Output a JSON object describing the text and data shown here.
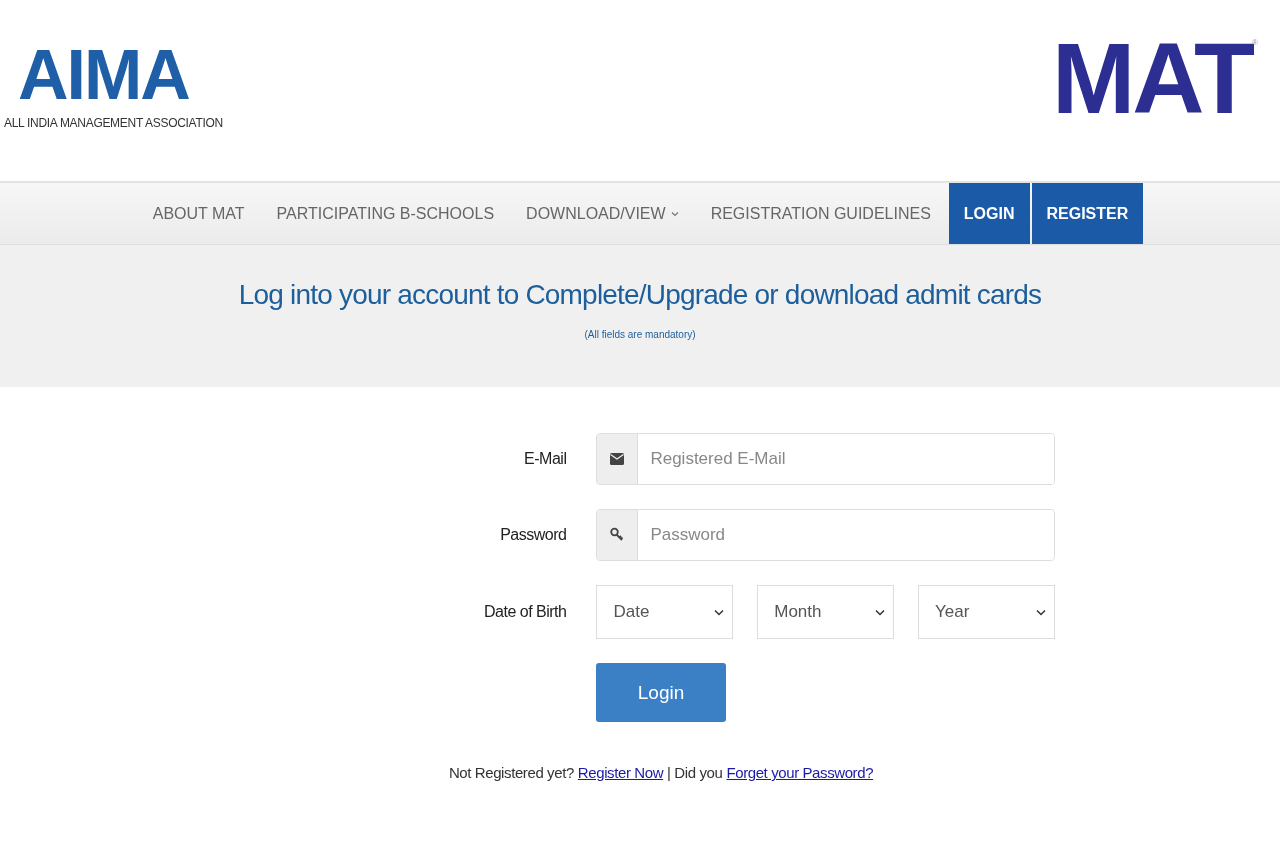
{
  "header": {
    "left_logo": {
      "mark": "AIMA",
      "subtitle": "ALL INDIA MANAGEMENT ASSOCIATION"
    },
    "right_logo": {
      "mark": "MAT",
      "registered": "®"
    }
  },
  "nav": [
    {
      "label": "ABOUT MAT",
      "kind": "link"
    },
    {
      "label": "PARTICIPATING B-SCHOOLS",
      "kind": "link"
    },
    {
      "label": "DOWNLOAD/VIEW",
      "kind": "dropdown"
    },
    {
      "label": "REGISTRATION GUIDELINES",
      "kind": "link"
    },
    {
      "label": "LOGIN",
      "kind": "button"
    },
    {
      "label": "REGISTER",
      "kind": "button"
    }
  ],
  "banner": {
    "title": "Log into your account to Complete/Upgrade or download admit cards",
    "note": "(All fields are mandatory)"
  },
  "form": {
    "email": {
      "label": "E-Mail",
      "placeholder": "Registered E-Mail"
    },
    "password": {
      "label": "Password",
      "placeholder": "Password"
    },
    "dob": {
      "label": "Date of Birth",
      "selects": [
        "Date",
        "Month",
        "Year"
      ]
    },
    "submit": "Login"
  },
  "footer_line": {
    "prompt": "Not Registered yet?",
    "register_link": "Register Now",
    "separator": "| Did you",
    "forgot_link": "Forget your Password?"
  }
}
